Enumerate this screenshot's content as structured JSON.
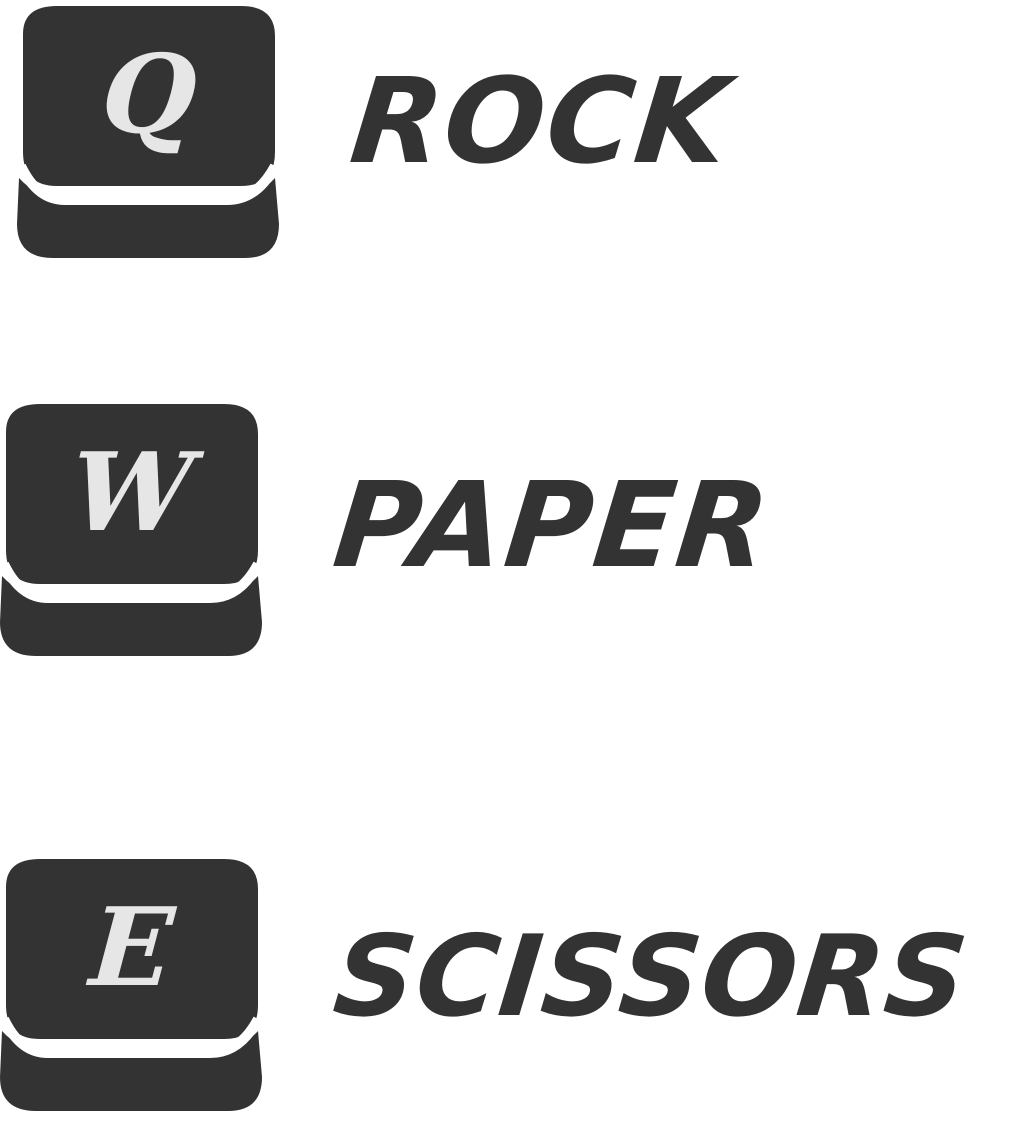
{
  "controls": [
    {
      "key": "Q",
      "action": "ROCK"
    },
    {
      "key": "W",
      "action": "PAPER"
    },
    {
      "key": "E",
      "action": "SCISSORS"
    }
  ],
  "colors": {
    "keycap": "#333333",
    "key_letter": "#e6e6e6",
    "label": "#333333",
    "background": "#ffffff"
  },
  "icons": {
    "keycap": "keyboard-key-icon"
  }
}
